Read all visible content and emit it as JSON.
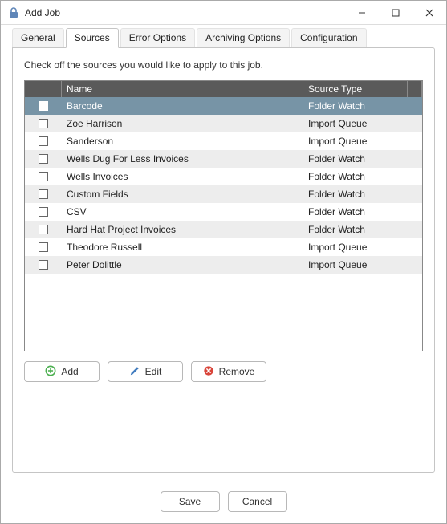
{
  "window": {
    "title": "Add Job"
  },
  "tabs": [
    {
      "label": "General",
      "active": false
    },
    {
      "label": "Sources",
      "active": true
    },
    {
      "label": "Error Options",
      "active": false
    },
    {
      "label": "Archiving Options",
      "active": false
    },
    {
      "label": "Configuration",
      "active": false
    }
  ],
  "instruction": "Check off the sources you would like to apply to this job.",
  "columns": {
    "name": "Name",
    "source_type": "Source Type"
  },
  "rows": [
    {
      "name": "Barcode",
      "type": "Folder Watch",
      "checked": false,
      "selected": true
    },
    {
      "name": "Zoe Harrison",
      "type": "Import Queue",
      "checked": false,
      "selected": false
    },
    {
      "name": "Sanderson",
      "type": "Import Queue",
      "checked": false,
      "selected": false
    },
    {
      "name": "Wells Dug For Less Invoices",
      "type": "Folder Watch",
      "checked": false,
      "selected": false
    },
    {
      "name": "Wells Invoices",
      "type": "Folder Watch",
      "checked": false,
      "selected": false
    },
    {
      "name": "Custom Fields",
      "type": "Folder Watch",
      "checked": false,
      "selected": false
    },
    {
      "name": "CSV",
      "type": "Folder Watch",
      "checked": false,
      "selected": false
    },
    {
      "name": "Hard Hat Project Invoices",
      "type": "Folder Watch",
      "checked": false,
      "selected": false
    },
    {
      "name": "Theodore Russell",
      "type": "Import Queue",
      "checked": false,
      "selected": false
    },
    {
      "name": "Peter Dolittle",
      "type": "Import Queue",
      "checked": false,
      "selected": false
    }
  ],
  "buttons": {
    "add": "Add",
    "edit": "Edit",
    "remove": "Remove",
    "save": "Save",
    "cancel": "Cancel"
  },
  "colors": {
    "add_icon": "#4caf50",
    "edit_icon": "#3f7bbf",
    "remove_icon": "#d9453a"
  }
}
